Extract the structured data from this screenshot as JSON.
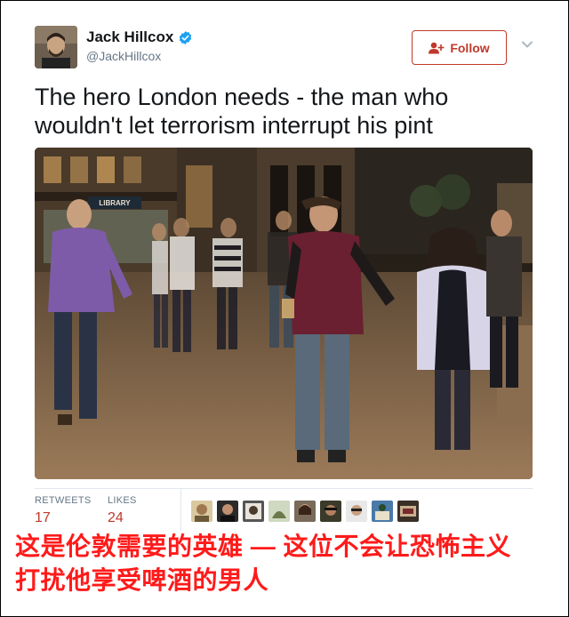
{
  "tweet": {
    "author": {
      "display_name": "Jack Hillcox",
      "handle": "@JackHillcox",
      "verified": true,
      "avatar_icon": "user-avatar"
    },
    "follow_label": "Follow",
    "menu_icon": "chevron-down-icon",
    "text": "The hero London needs - the man who wouldn't let terrorism interrupt his pint",
    "media": {
      "storefront_sign": "LIBRARY"
    },
    "stats": {
      "retweets_label": "RETWEETS",
      "retweets_count": "17",
      "likes_label": "LIKES",
      "likes_count": "24"
    },
    "likers_count_shown": 9
  },
  "caption": {
    "line1": "这是伦敦需要的英雄 — 这位不会让恐怖主义",
    "line2": "打扰他享受啤酒的男人"
  },
  "colors": {
    "follow": "#c0392b",
    "verified": "#1da1f2",
    "caption": "#ff1a1a",
    "stat_value": "#c0392b"
  }
}
